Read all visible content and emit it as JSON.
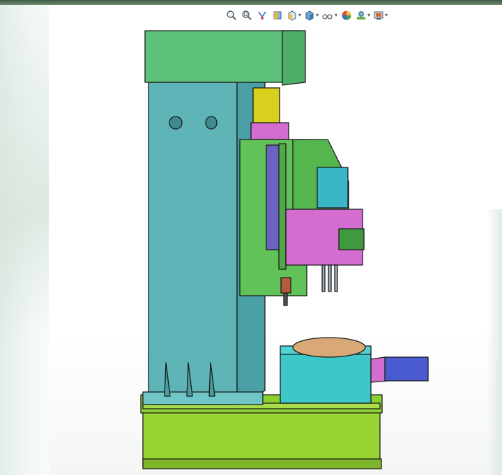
{
  "window": {
    "title": ""
  },
  "heads_up_toolbar": {
    "items": [
      {
        "name": "zoom-to-fit-icon",
        "has_dropdown": false
      },
      {
        "name": "zoom-to-area-icon",
        "has_dropdown": false
      },
      {
        "name": "previous-view-icon",
        "has_dropdown": false
      },
      {
        "name": "section-view-icon",
        "has_dropdown": false
      },
      {
        "name": "view-orientation-icon",
        "has_dropdown": true
      },
      {
        "name": "display-style-icon",
        "has_dropdown": true
      },
      {
        "name": "hide-show-items-icon",
        "has_dropdown": true
      },
      {
        "name": "edit-appearance-icon",
        "has_dropdown": false
      },
      {
        "name": "apply-scene-icon",
        "has_dropdown": true
      },
      {
        "name": "view-settings-icon",
        "has_dropdown": true
      }
    ]
  },
  "model": {
    "name": "",
    "colors": {
      "column": "#5fb4b7",
      "head": "#62c25a",
      "top_cap": "#5ec27a",
      "motor_block": "#d36ed0",
      "cylinder": "#d9cf1d",
      "base": "#99d434",
      "rotary_table": "#3ec7c9",
      "turntable_plate": "#d9a877",
      "servo_motor": "#4a5bd1",
      "rail": "#6a63c2",
      "outline": "#1a1a1a"
    }
  }
}
